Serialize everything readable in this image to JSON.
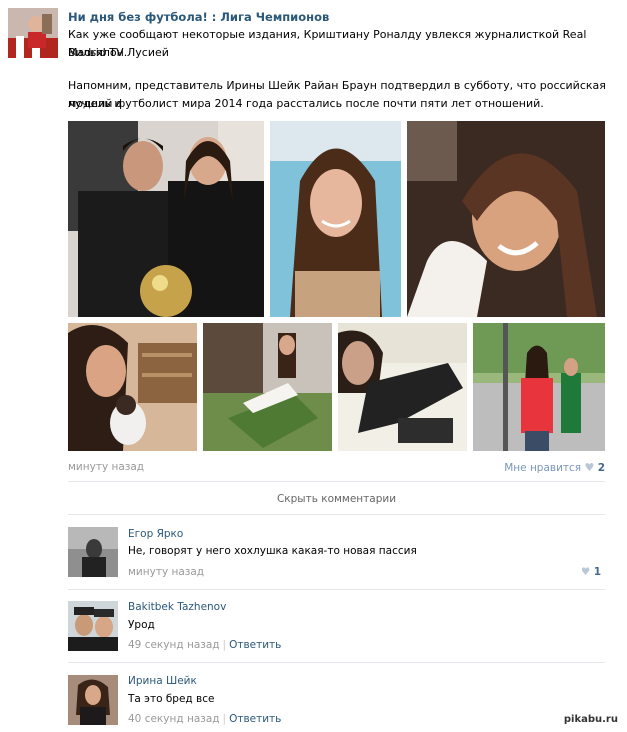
{
  "post": {
    "group_name": "Ни дня без футбола! : Лига Чемпионов",
    "text_line1": "Как уже сообщают некоторые издания, Криштиану Роналду увлекся журналисткой Real Madrid TV Лусией",
    "text_line2": "Вильялон.",
    "text_line3": "Напомним, представитель Ирины Шейк Райан Браун подтвердил в субботу, что российская модель и",
    "text_line4": "лучший футболист мира 2014 года расстались после почти пяти лет отношений.",
    "time": "минуту назад",
    "like_label": "Мне нравится",
    "like_count": "2",
    "hide_comments": "Скрыть комментарии"
  },
  "comments": [
    {
      "author": "Егор Ярко",
      "text": "Не, говорят у него хохлушка какая-то новая пассия",
      "time": "минуту назад",
      "likes": "1"
    },
    {
      "author": "Bakitbek Tazhenov",
      "text": "Урод",
      "time": "49 секунд назад",
      "reply": "Ответить"
    },
    {
      "author": "Ирина Шейк",
      "text": "Та это бред все",
      "time": "40 секунд назад",
      "reply": "Ответить"
    }
  ],
  "watermark": "pikabu.ru",
  "icons": {
    "like": "heart-icon"
  },
  "colors": {
    "link": "#2b587a",
    "meta": "#999999",
    "separator": "#e4e8ed"
  }
}
